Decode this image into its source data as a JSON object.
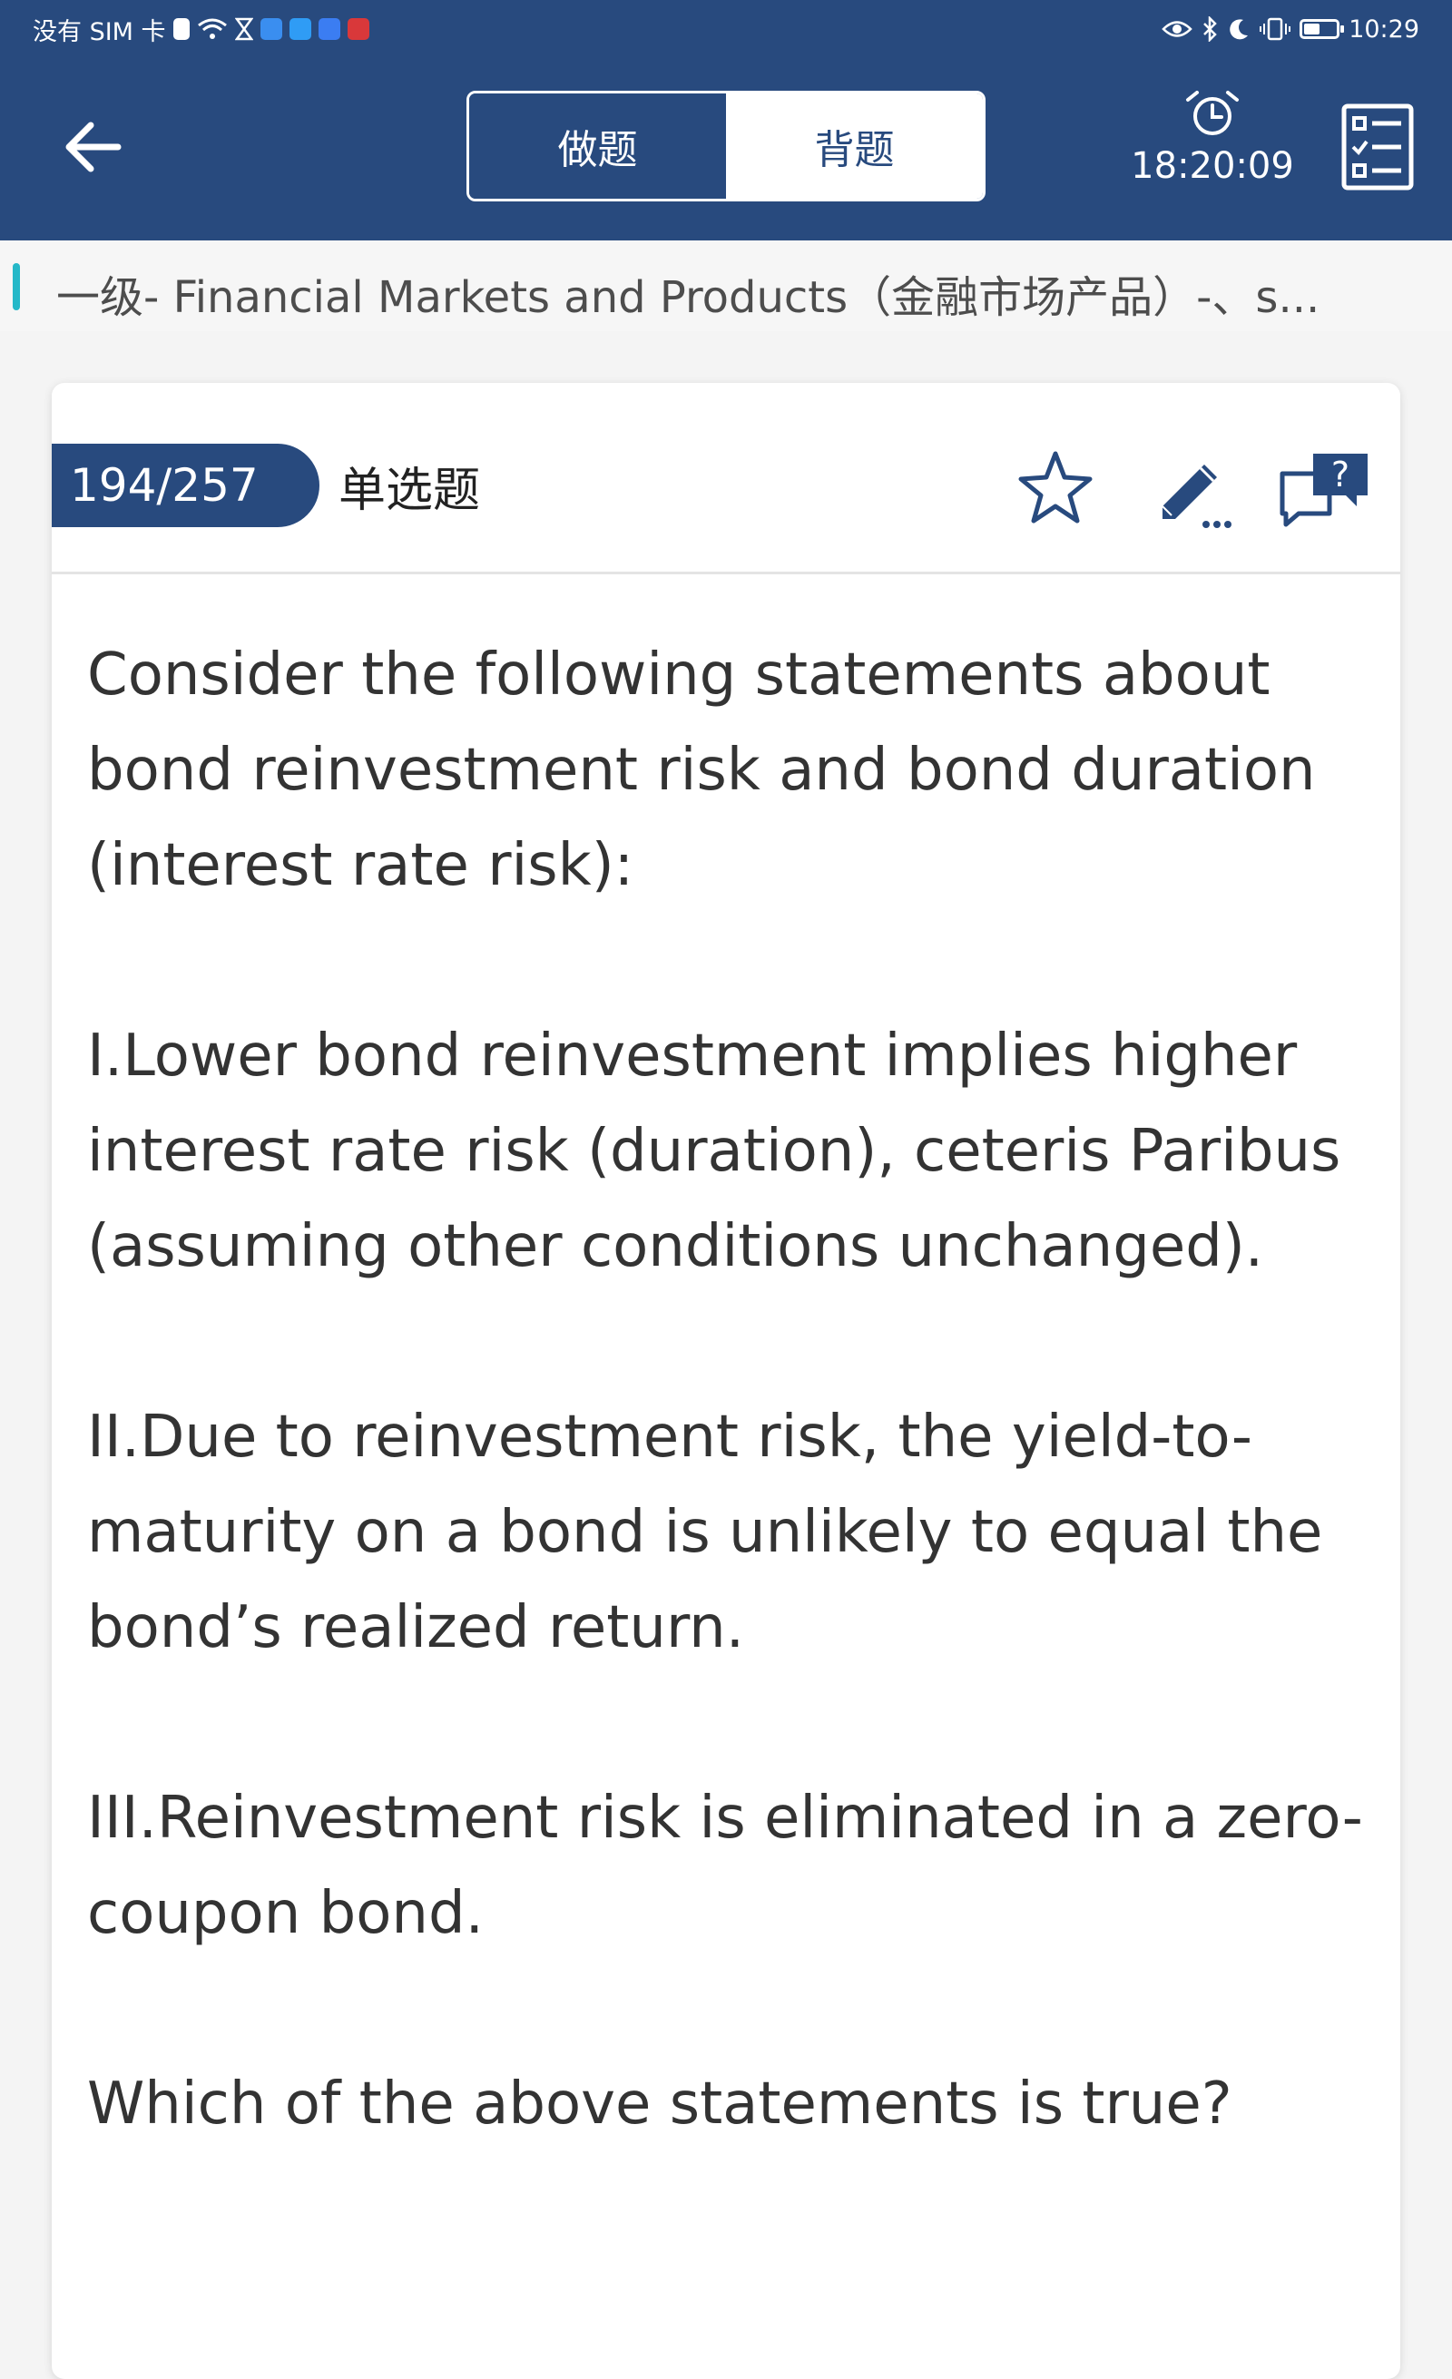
{
  "status_bar": {
    "carrier": "没有 SIM 卡",
    "time": "10:29"
  },
  "header": {
    "mode_tabs": [
      {
        "label": "做题",
        "active": true
      },
      {
        "label": "背题",
        "active": false
      }
    ],
    "timer": "18:20:09"
  },
  "breadcrumb": {
    "text": "一级- Financial Markets and Products（金融市场产品）-、s..."
  },
  "question": {
    "progress": "194/257",
    "type": "单选题",
    "paragraphs": [
      "Consider the following statements about bond reinvestment risk and bond duration (interest rate risk):",
      "I.Lower bond reinvestment implies higher interest rate risk (duration), ceteris Paribus (assuming other conditions unchanged).",
      "II.Due to reinvestment risk, the yield-to-maturity on a bond is unlikely to equal the bond’s realized return.",
      "III.Reinvestment risk is eliminated in a zero-coupon bond.",
      "Which of the above statements is true?"
    ]
  },
  "colors": {
    "primary": "#284a7e",
    "accent": "#25b8c8",
    "background": "#f4f4f4"
  },
  "icons": [
    "back-arrow-icon",
    "alarm-clock-icon",
    "answer-sheet-icon",
    "star-icon",
    "pencil-note-icon",
    "question-feedback-icon"
  ]
}
